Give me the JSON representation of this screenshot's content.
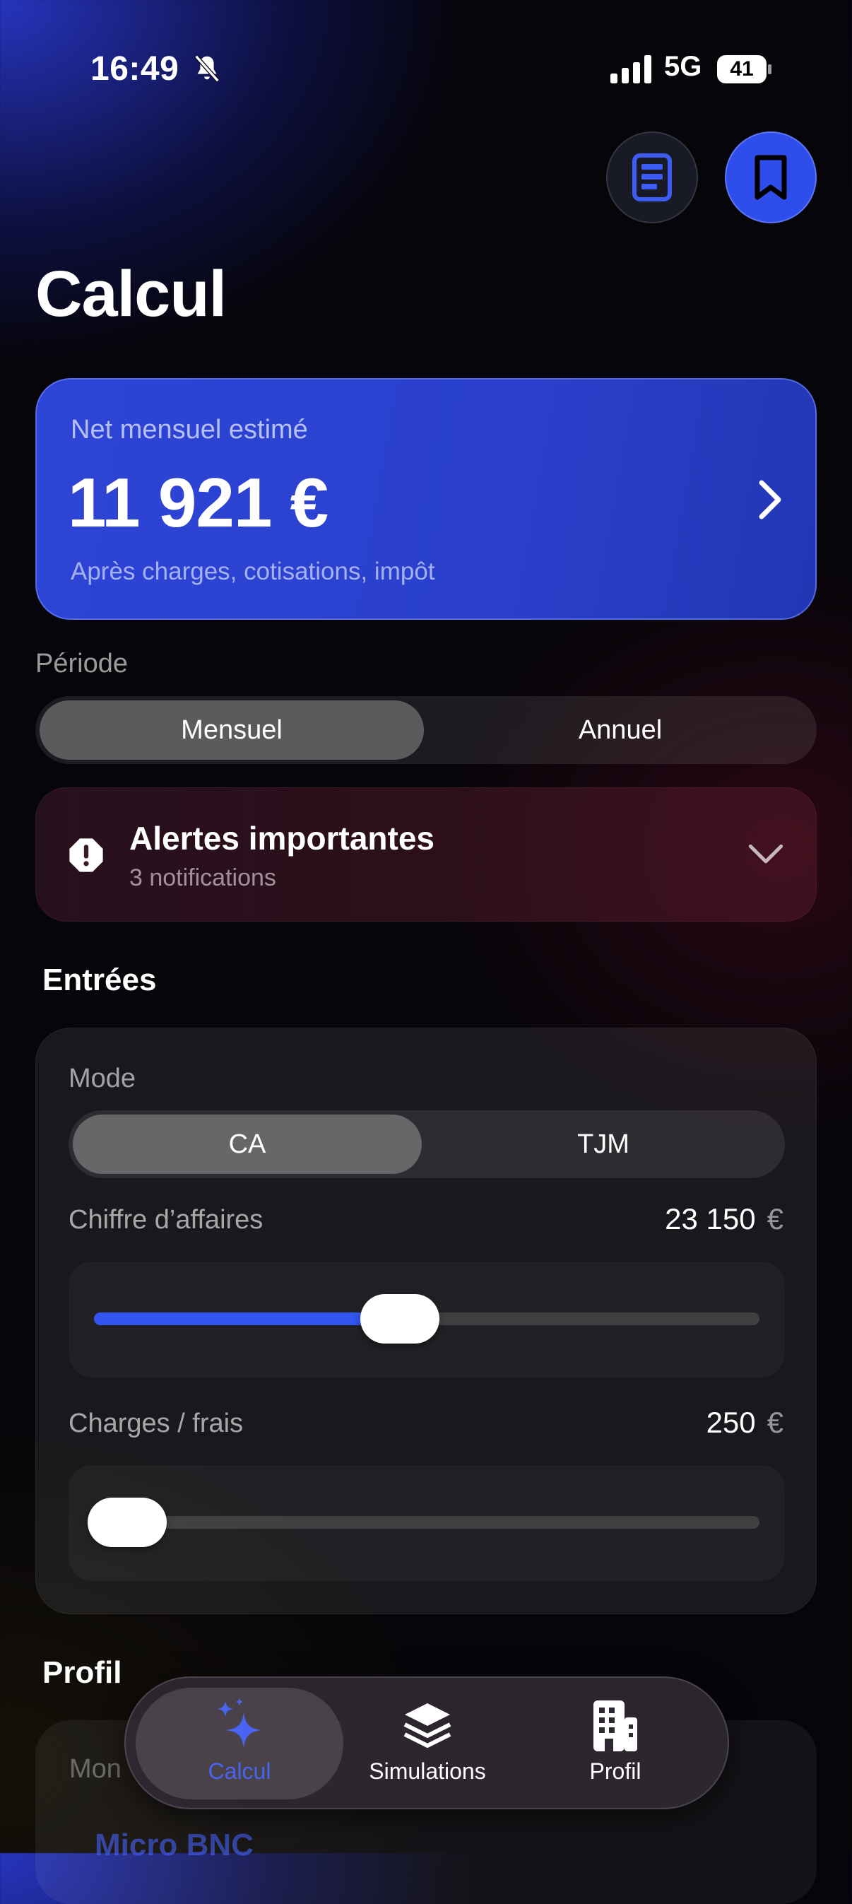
{
  "status_bar": {
    "time": "16:49",
    "network": "5G",
    "battery": "41"
  },
  "header": {
    "title": "Calcul"
  },
  "hero": {
    "label": "Net mensuel estimé",
    "value": "11 921 €",
    "subtitle": "Après charges, cotisations, impôt"
  },
  "period": {
    "label": "Période",
    "options": [
      "Mensuel",
      "Annuel"
    ],
    "selected": "Mensuel"
  },
  "alerts": {
    "title": "Alertes importantes",
    "subtitle": "3 notifications"
  },
  "inputs": {
    "heading": "Entrées",
    "mode_label": "Mode",
    "mode_options": [
      "CA",
      "TJM"
    ],
    "mode_selected": "CA",
    "revenue": {
      "label": "Chiffre d’affaires",
      "value": "23 150",
      "currency": "€",
      "slider_fraction": 0.46
    },
    "charges": {
      "label": "Charges / frais",
      "value": "250",
      "currency": "€",
      "slider_fraction": 0.05
    }
  },
  "profile": {
    "heading": "Profil",
    "field_label": "Mon",
    "field_value": "Micro BNC"
  },
  "tabbar": {
    "tabs": [
      {
        "label": "Calcul",
        "icon": "sparkles-icon"
      },
      {
        "label": "Simulations",
        "icon": "layers-icon"
      },
      {
        "label": "Profil",
        "icon": "building-icon"
      }
    ],
    "active": "Calcul"
  },
  "colors": {
    "accent": "#2f4dea",
    "tab_active": "#4a63f0"
  }
}
